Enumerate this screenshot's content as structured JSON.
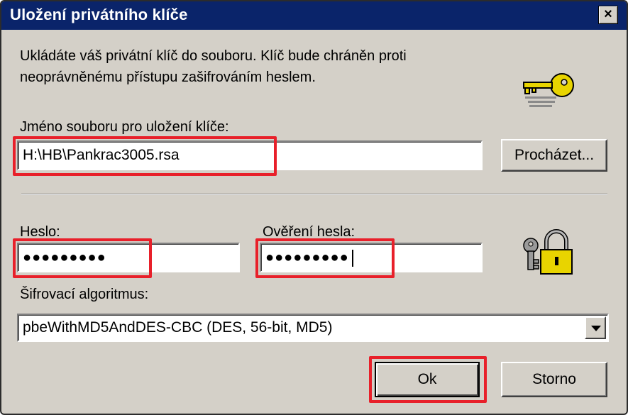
{
  "window": {
    "title": "Uložení privátního klíče",
    "close_symbol": "×"
  },
  "description": "Ukládáte váš privátní klíč do souboru. Klíč bude chráněn proti neoprávněnému přístupu zašifrováním heslem.",
  "icons": {
    "key_icon": "key-icon",
    "lock_icon": "padlock-icon"
  },
  "file": {
    "label": "Jméno souboru pro uložení klíče:",
    "value": "H:\\HB\\Pankrac3005.rsa",
    "browse_label": "Procházet..."
  },
  "password": {
    "label": "Heslo:",
    "value": "●●●●●●●●●"
  },
  "password_confirm": {
    "label": "Ověření hesla:",
    "value": "●●●●●●●●●"
  },
  "cipher": {
    "label": "Šifrovací algoritmus:",
    "selected": "pbeWithMD5AndDES-CBC (DES, 56-bit, MD5)"
  },
  "buttons": {
    "ok": "Ok",
    "cancel": "Storno"
  },
  "colors": {
    "titlebar": "#0a246a",
    "dialog_bg": "#d4d0c8",
    "highlight": "#e8202a",
    "key_gold": "#e8d400"
  }
}
